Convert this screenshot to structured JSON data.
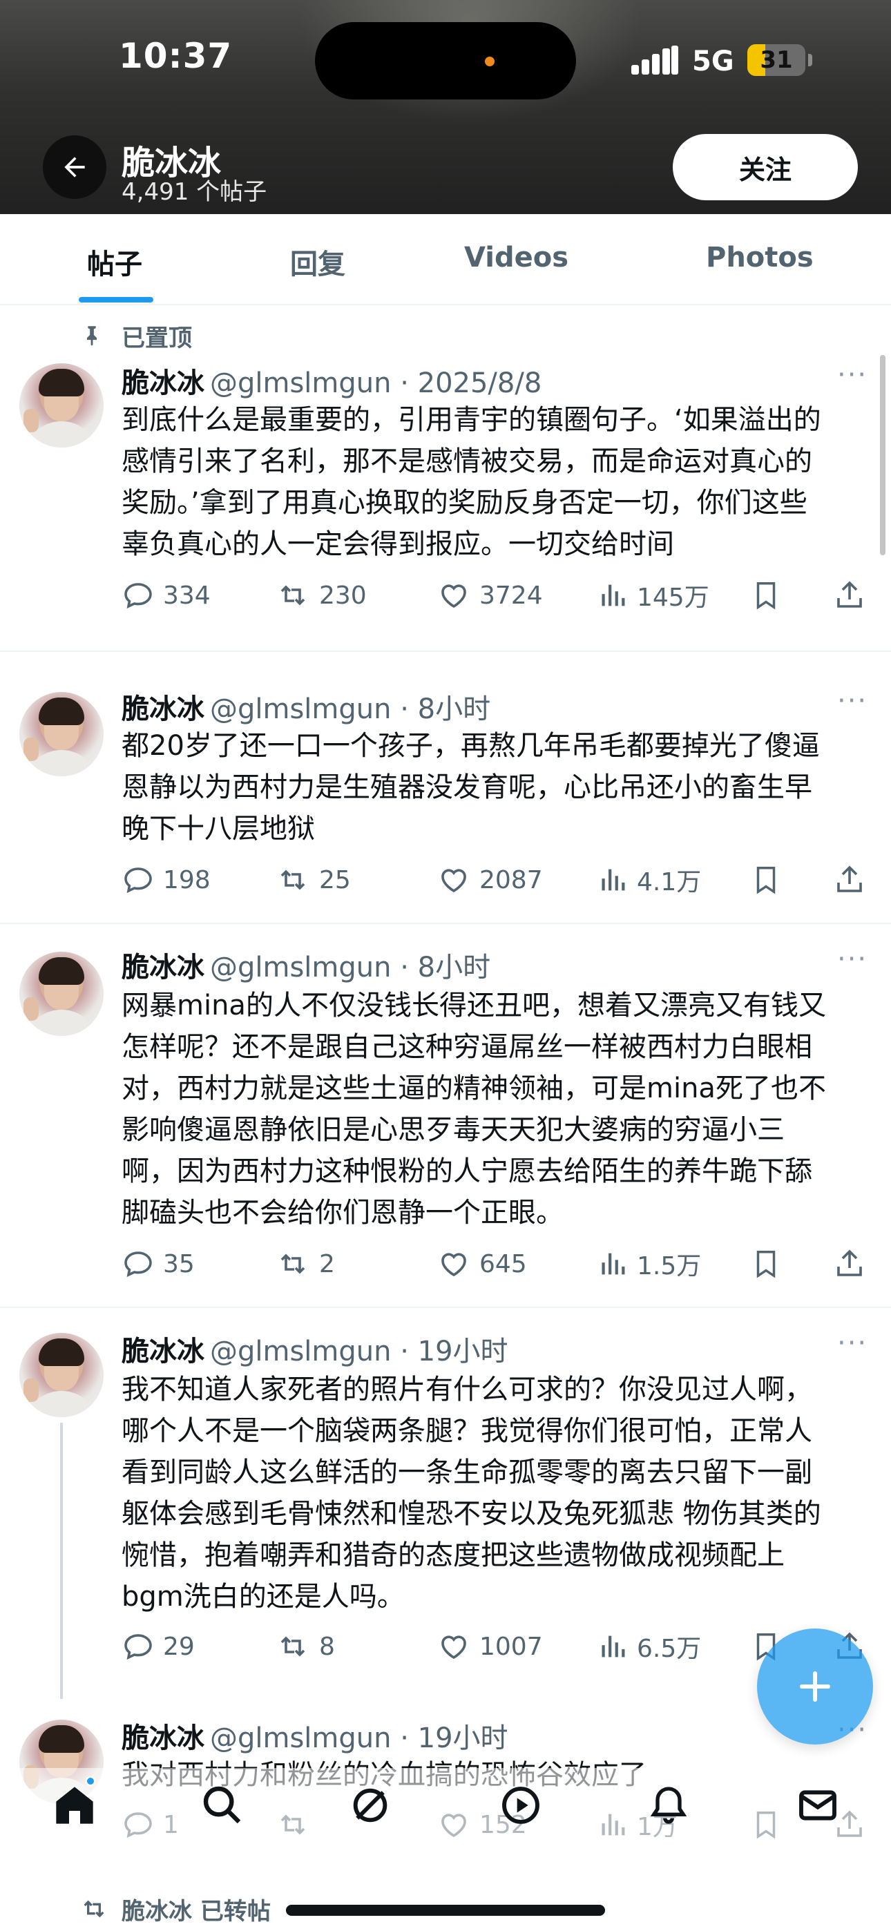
{
  "status_bar": {
    "time": "10:37",
    "network": "5G",
    "battery": "31",
    "battery_level": 0.31,
    "accent_color": "#f5c400"
  },
  "header": {
    "name": "脆冰冰",
    "post_count": "4,491 个帖子",
    "follow_label": "关注",
    "back_icon": "arrow-left-icon"
  },
  "tabs": [
    {
      "label": "帖子",
      "active": true
    },
    {
      "label": "回复",
      "active": false
    },
    {
      "label": "Videos",
      "active": false
    },
    {
      "label": "Photos",
      "active": false
    }
  ],
  "pinned_label": "已置顶",
  "more_glyph": "···",
  "posts": [
    {
      "name": "脆冰冰",
      "meta": "@glmslmgun · 2025/8/8",
      "lines": [
        "到底什么是最重要的，引用青宇的镇圈句子。‘如果溢出的",
        "感情引来了名利，那不是感情被交易，而是命运对真心的",
        "奖励。’拿到了用真心换取的奖励反身否定一切，你们这些",
        "辜负真心的人一定会得到报应。一切交给时间"
      ],
      "replies": "334",
      "reposts": "230",
      "likes": "3724",
      "views": "145万"
    },
    {
      "name": "脆冰冰",
      "meta": "@glmslmgun · 8小时",
      "lines": [
        "都20岁了还一口一个孩子，再熬几年吊毛都要掉光了傻逼",
        "恩静以为西村力是生殖器没发育呢，心比吊还小的畜生早",
        "晚下十八层地狱"
      ],
      "replies": "198",
      "reposts": "25",
      "likes": "2087",
      "views": "4.1万"
    },
    {
      "name": "脆冰冰",
      "meta": "@glmslmgun · 8小时",
      "lines": [
        "网暴mina的人不仅没钱长得还丑吧，想着又漂亮又有钱又",
        "怎样呢？还不是跟自己这种穷逼屌丝一样被西村力白眼相",
        "对，西村力就是这些土逼的精神领袖，可是mina死了也不",
        "影响傻逼恩静依旧是心思歹毒天天犯大婆病的穷逼小三",
        "啊，因为西村力这种恨粉的人宁愿去给陌生的养牛跪下舔",
        "脚磕头也不会给你们恩静一个正眼。"
      ],
      "replies": "35",
      "reposts": "2",
      "likes": "645",
      "views": "1.5万"
    },
    {
      "name": "脆冰冰",
      "meta": "@glmslmgun · 19小时",
      "lines": [
        "我不知道人家死者的照片有什么可求的？你没见过人啊，",
        "哪个人不是一个脑袋两条腿？我觉得你们很可怕，正常人",
        "看到同龄人这么鲜活的一条生命孤零零的离去只留下一副",
        "躯体会感到毛骨悚然和惶恐不安以及兔死狐悲 物伤其类的",
        "惋惜，抱着嘲弄和猎奇的态度把这些遗物做成视频配上",
        "bgm洗白的还是人吗。"
      ],
      "replies": "29",
      "reposts": "8",
      "likes": "1007",
      "views": "6.5万"
    },
    {
      "name": "脆冰冰",
      "meta": "@glmslmgun · 19小时",
      "lines": [
        "我对西村力和粉丝的冷血搞的恐怖谷效应了"
      ],
      "replies": "1",
      "reposts": "",
      "likes": "152",
      "views": "1万"
    }
  ],
  "repost_label": "脆冰冰 已转帖",
  "colors": {
    "accent": "#1d9bf0",
    "secondary_text": "#536471"
  }
}
